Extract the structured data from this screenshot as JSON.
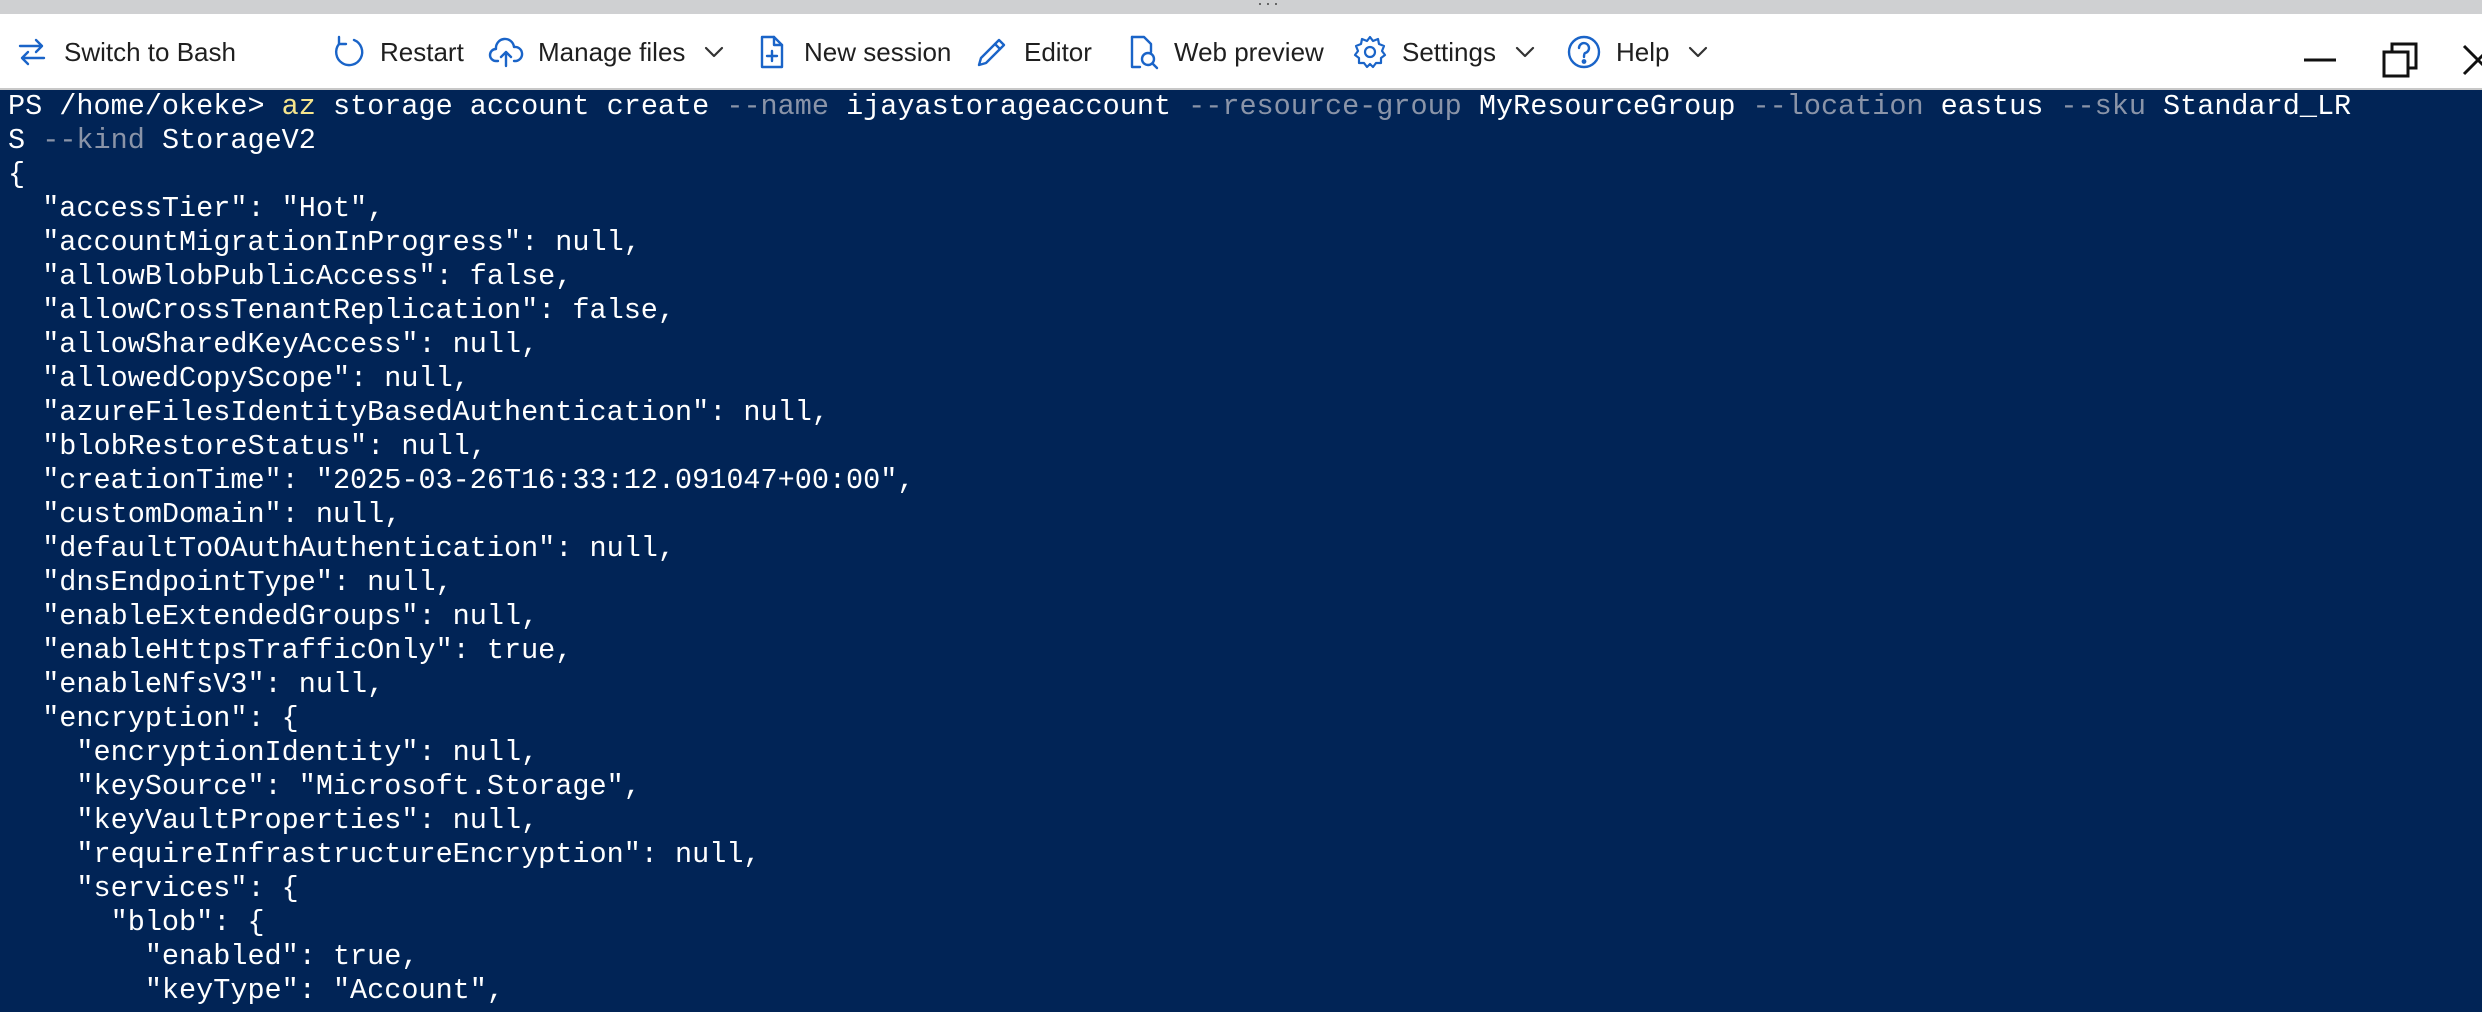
{
  "toolbar": {
    "switch_label": "Switch to Bash",
    "restart_label": "Restart",
    "manage_files_label": "Manage files",
    "new_session_label": "New session",
    "editor_label": "Editor",
    "web_preview_label": "Web preview",
    "settings_label": "Settings",
    "help_label": "Help"
  },
  "terminal": {
    "prompt": "PS /home/okeke> ",
    "command": "az",
    "cmd_parts": [
      {
        "t": " storage account create ",
        "c": "plain"
      },
      {
        "t": "--name",
        "c": "param"
      },
      {
        "t": " ijayastorageaccount ",
        "c": "plain"
      },
      {
        "t": "--resource-group",
        "c": "param"
      },
      {
        "t": " MyResourceGroup ",
        "c": "plain"
      },
      {
        "t": "--location",
        "c": "param"
      },
      {
        "t": " eastus ",
        "c": "plain"
      },
      {
        "t": "--sku",
        "c": "param"
      },
      {
        "t": " Standard_LR",
        "c": "plain"
      }
    ],
    "cmd_wrap_parts": [
      {
        "t": "S ",
        "c": "plain"
      },
      {
        "t": "--kind",
        "c": "param"
      },
      {
        "t": " StorageV2",
        "c": "plain"
      }
    ],
    "output_lines": [
      "{",
      "  \"accessTier\": \"Hot\",",
      "  \"accountMigrationInProgress\": null,",
      "  \"allowBlobPublicAccess\": false,",
      "  \"allowCrossTenantReplication\": false,",
      "  \"allowSharedKeyAccess\": null,",
      "  \"allowedCopyScope\": null,",
      "  \"azureFilesIdentityBasedAuthentication\": null,",
      "  \"blobRestoreStatus\": null,",
      "  \"creationTime\": \"2025-03-26T16:33:12.091047+00:00\",",
      "  \"customDomain\": null,",
      "  \"defaultToOAuthAuthentication\": null,",
      "  \"dnsEndpointType\": null,",
      "  \"enableExtendedGroups\": null,",
      "  \"enableHttpsTrafficOnly\": true,",
      "  \"enableNfsV3\": null,",
      "  \"encryption\": {",
      "    \"encryptionIdentity\": null,",
      "    \"keySource\": \"Microsoft.Storage\",",
      "    \"keyVaultProperties\": null,",
      "    \"requireInfrastructureEncryption\": null,",
      "    \"services\": {",
      "      \"blob\": {",
      "        \"enabled\": true,",
      "        \"keyType\": \"Account\","
    ]
  },
  "icons": {
    "switch": "switch-arrows-icon",
    "restart": "restart-icon",
    "manage_files": "cloud-upload-icon",
    "new_session": "new-file-icon",
    "editor": "pen-icon",
    "web_preview": "web-preview-icon",
    "settings": "gear-icon",
    "help": "help-circle-icon"
  },
  "colors": {
    "terminal_bg": "#012456",
    "command_yellow": "#f6e58d",
    "param_gray": "#8a94a8",
    "icon_blue": "#1a64c8"
  }
}
